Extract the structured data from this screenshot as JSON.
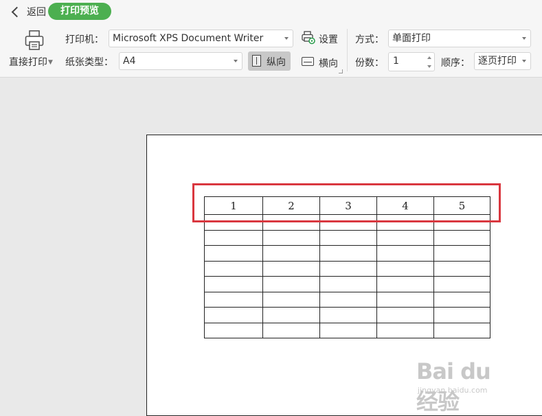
{
  "header": {
    "back_label": "返回",
    "mode_label": "打印预览"
  },
  "printer": {
    "direct_print_label": "直接打印",
    "printer_label": "打印机：",
    "printer_value": "Microsoft XPS Document Writer",
    "settings_label": "设置",
    "paper_type_label": "纸张类型：",
    "paper_type_value": "A4",
    "portrait_label": "纵向",
    "landscape_label": "横向"
  },
  "options": {
    "mode_label": "方式：",
    "mode_value": "单面打印",
    "copies_label": "份数：",
    "copies_value": "1",
    "order_label": "顺序：",
    "order_value": "逐页打印"
  },
  "preview": {
    "header_row": [
      "1",
      "2",
      "3",
      "4",
      "5"
    ],
    "empty_rows": 8
  },
  "watermark": {
    "main": "Bai du 经验",
    "sub": "jingyan.baidu.com"
  },
  "colors": {
    "accent_green": "#4caf50",
    "highlight_red": "#d9373f"
  }
}
